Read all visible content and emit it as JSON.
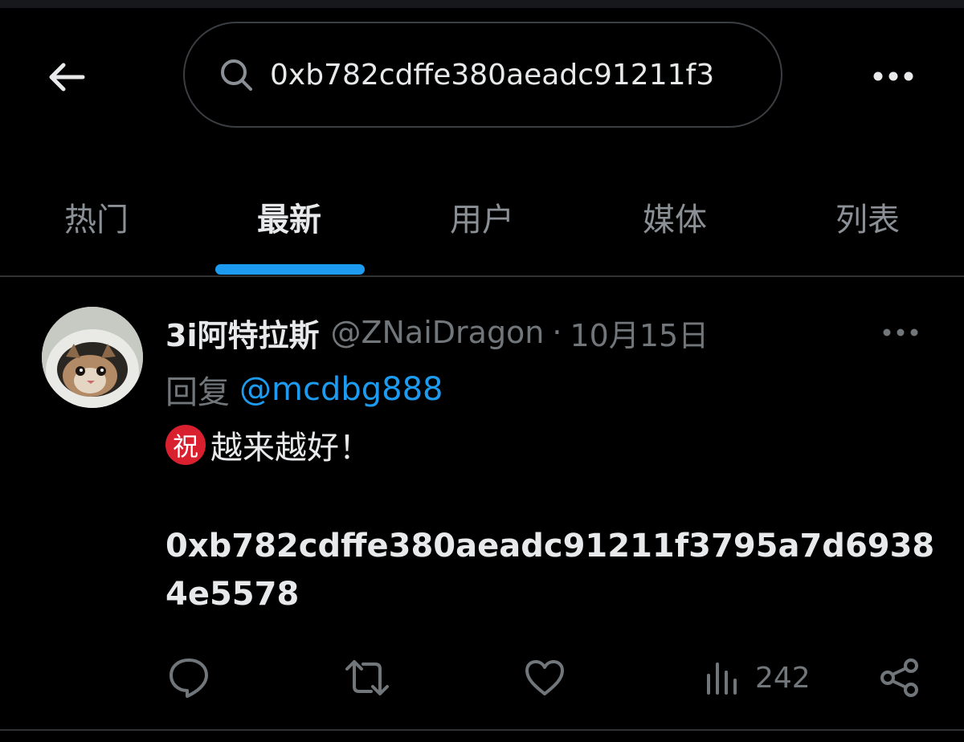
{
  "header": {
    "search_value": "0xb782cdffe380aeadc91211f3"
  },
  "tabs": [
    {
      "label": "热门"
    },
    {
      "label": "最新"
    },
    {
      "label": "用户"
    },
    {
      "label": "媒体"
    },
    {
      "label": "列表"
    }
  ],
  "active_tab_index": 1,
  "post": {
    "display_name": "3i阿特拉斯",
    "handle": "@ZNaiDragon",
    "separator": "·",
    "date": "10月15日",
    "reply_label": "回复",
    "reply_mention": "@mcdbg888",
    "emoji_char": "祝",
    "text_line1": "越来越好！",
    "hash_text": "0xb782cdffe380aeadc91211f3795a7d69384e5578",
    "views": "242"
  },
  "icons": {
    "back": "back-arrow-icon",
    "search": "search-icon",
    "more": "more-horizontal-icon",
    "reply": "comment-icon",
    "retweet": "retweet-icon",
    "like": "heart-icon",
    "views": "analytics-icon",
    "share": "share-icon"
  },
  "colors": {
    "accent": "#1d9bf0",
    "emoji_badge": "#d9202f"
  }
}
